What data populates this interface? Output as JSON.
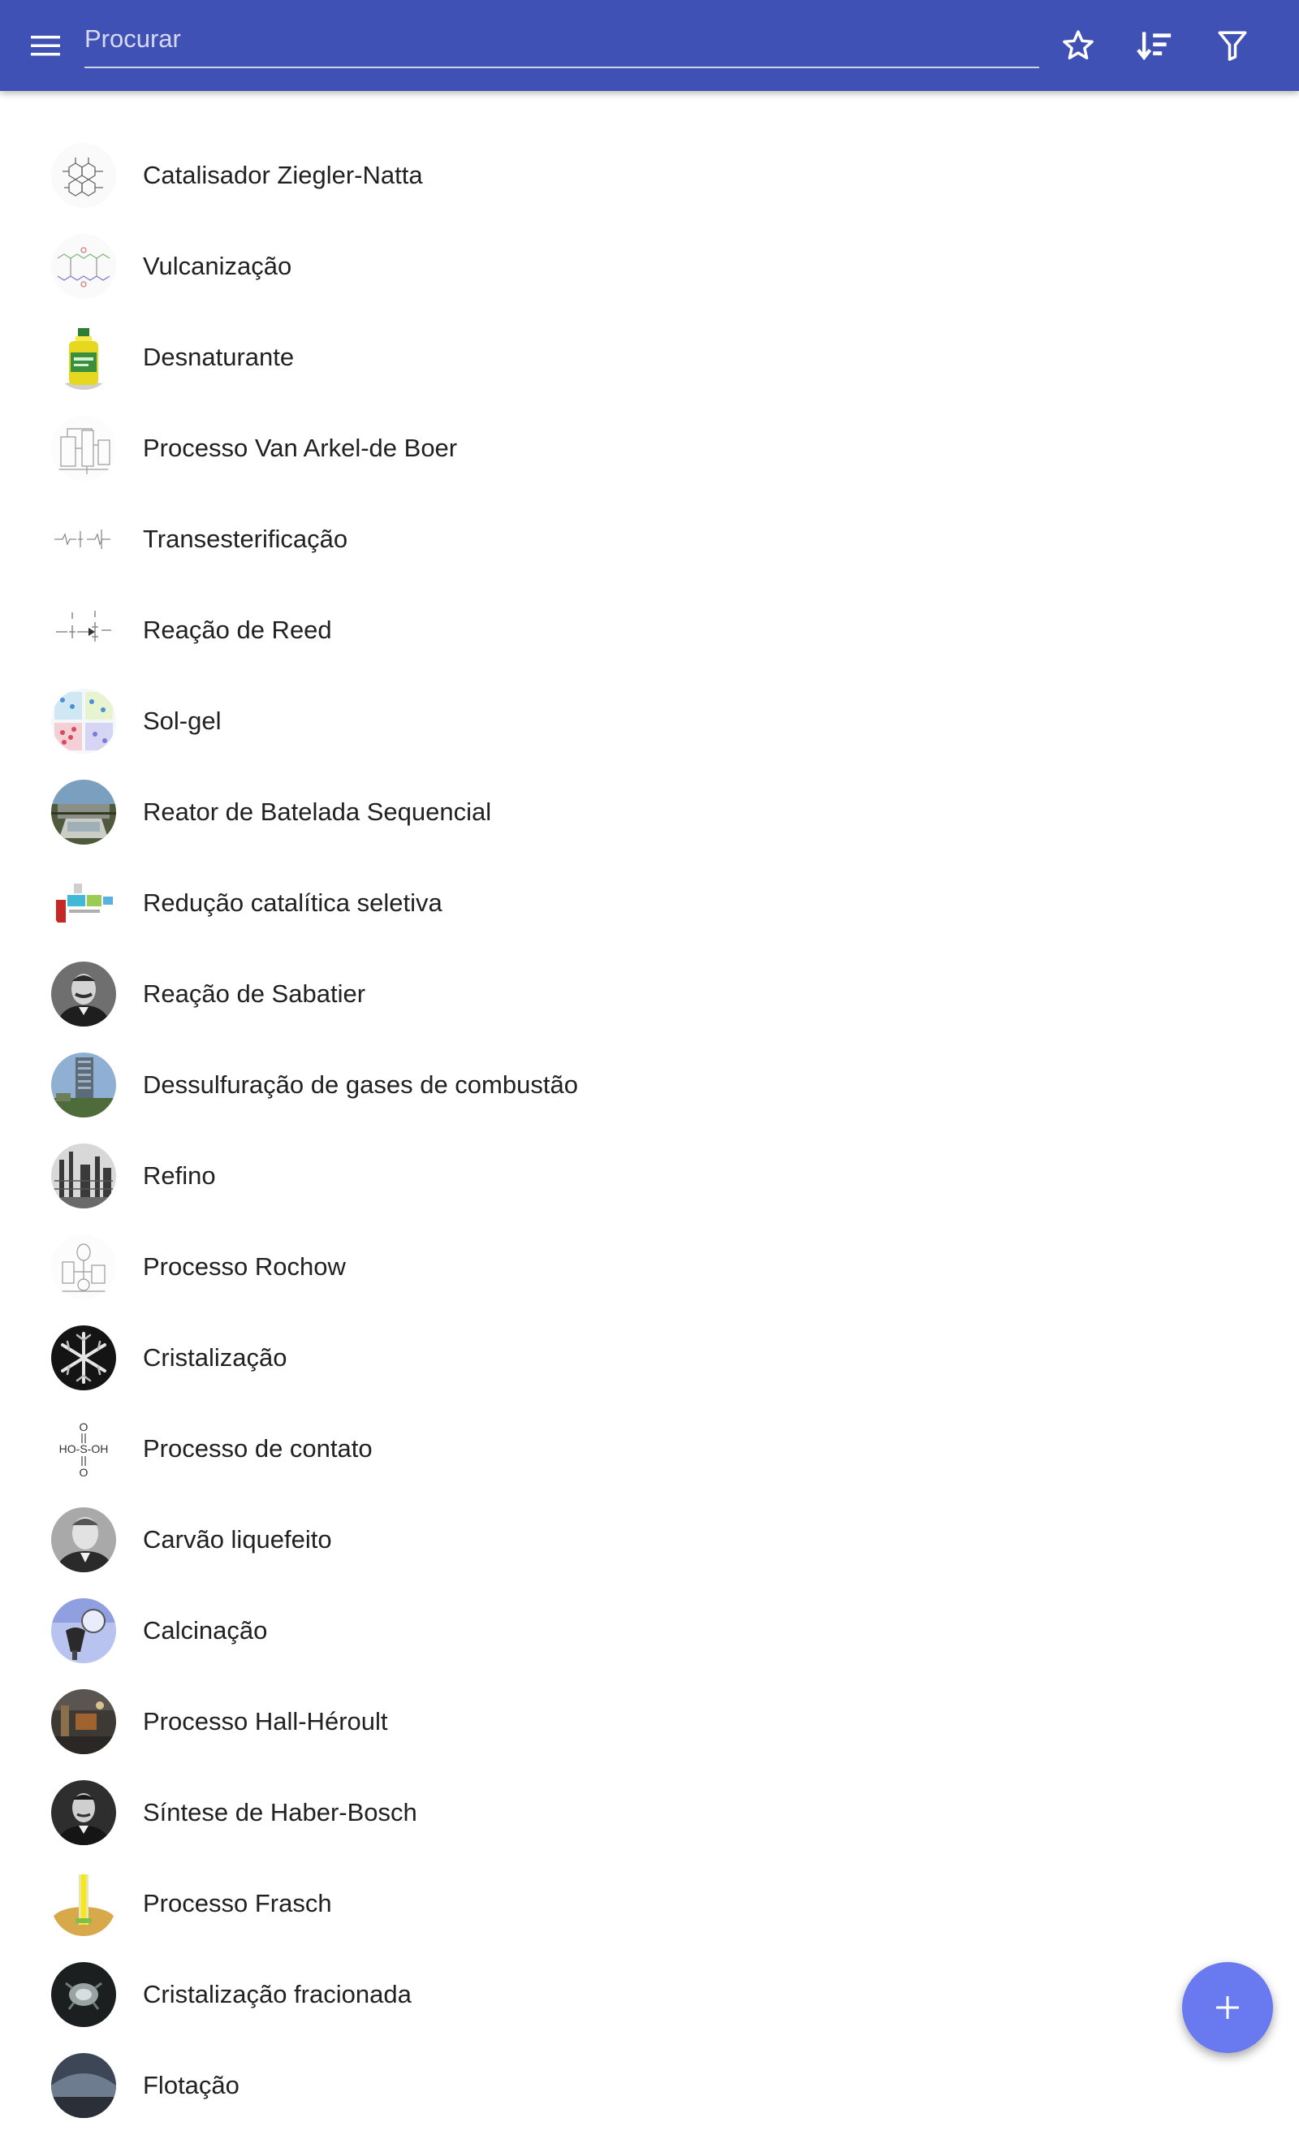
{
  "toolbar": {
    "search_placeholder": "Procurar",
    "menu_icon": "menu-icon",
    "actions": [
      "star-icon",
      "sort-icon",
      "filter-icon"
    ]
  },
  "colors": {
    "appbar": "#3f51b5",
    "fab": "#6979f0",
    "text": "#212121"
  },
  "items": [
    {
      "label": "Catalisador Ziegler-Natta",
      "icon": "chemical-structure-thumbnail"
    },
    {
      "label": "Vulcanização",
      "icon": "chemical-structure-thumbnail"
    },
    {
      "label": "Desnaturante",
      "icon": "bottle-thumbnail"
    },
    {
      "label": "Processo Van Arkel-de Boer",
      "icon": "apparatus-diagram-thumbnail"
    },
    {
      "label": "Transesterificação",
      "icon": "chemical-structure-thumbnail"
    },
    {
      "label": "Reação de Reed",
      "icon": "reaction-diagram-thumbnail"
    },
    {
      "label": "Sol-gel",
      "icon": "sol-gel-diagram-thumbnail"
    },
    {
      "label": "Reator de Batelada Sequencial",
      "icon": "reactor-photo-thumbnail"
    },
    {
      "label": "Redução catalítica seletiva",
      "icon": "process-diagram-thumbnail"
    },
    {
      "label": "Reação de Sabatier",
      "icon": "portrait-thumbnail"
    },
    {
      "label": "Dessulfuração de gases de combustão",
      "icon": "tower-photo-thumbnail"
    },
    {
      "label": "Refino",
      "icon": "refinery-photo-thumbnail"
    },
    {
      "label": "Processo Rochow",
      "icon": "apparatus-diagram-thumbnail"
    },
    {
      "label": "Cristalização",
      "icon": "crystal-photo-thumbnail"
    },
    {
      "label": "Processo de contato",
      "icon": "sulfuric-acid-formula-thumbnail",
      "formula": [
        "O",
        "HO-S-OH",
        "O"
      ]
    },
    {
      "label": "Carvão liquefeito",
      "icon": "portrait-thumbnail"
    },
    {
      "label": "Calcinação",
      "icon": "lab-photo-thumbnail"
    },
    {
      "label": "Processo Hall-Héroult",
      "icon": "plant-photo-thumbnail"
    },
    {
      "label": "Síntese de Haber-Bosch",
      "icon": "portrait-thumbnail"
    },
    {
      "label": "Processo Frasch",
      "icon": "frasch-diagram-thumbnail"
    },
    {
      "label": "Cristalização fracionada",
      "icon": "crystal-photo-thumbnail"
    },
    {
      "label": "Flotação",
      "icon": "photo-thumbnail"
    }
  ],
  "fab": {
    "icon": "plus-icon"
  }
}
